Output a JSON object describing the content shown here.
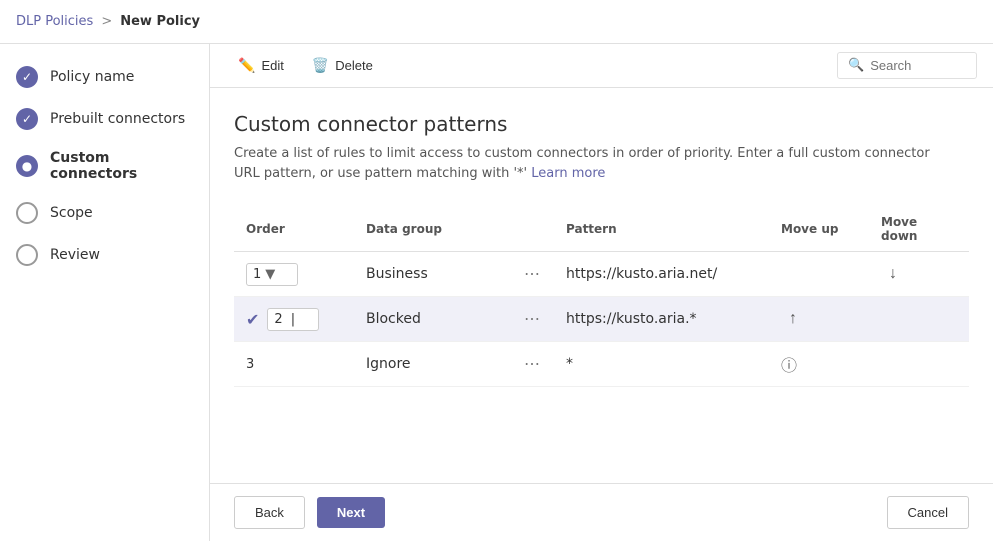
{
  "breadcrumb": {
    "parent": "DLP Policies",
    "separator": ">",
    "current": "New Policy"
  },
  "sidebar": {
    "items": [
      {
        "id": "policy-name",
        "label": "Policy name",
        "state": "completed",
        "stepNum": ""
      },
      {
        "id": "prebuilt-connectors",
        "label": "Prebuilt connectors",
        "state": "completed",
        "stepNum": ""
      },
      {
        "id": "custom-connectors",
        "label": "Custom connectors",
        "state": "active",
        "stepNum": ""
      },
      {
        "id": "scope",
        "label": "Scope",
        "state": "inactive",
        "stepNum": ""
      },
      {
        "id": "review",
        "label": "Review",
        "state": "inactive",
        "stepNum": ""
      }
    ]
  },
  "toolbar": {
    "edit_label": "Edit",
    "delete_label": "Delete",
    "search_placeholder": "Search"
  },
  "page": {
    "title": "Custom connector patterns",
    "description": "Create a list of rules to limit access to custom connectors in order of priority. Enter a full custom connector URL pattern, or use pattern matching with '*'",
    "learn_more": "Learn more"
  },
  "table": {
    "columns": {
      "order": "Order",
      "data_group": "Data group",
      "pattern": "Pattern",
      "move_up": "Move up",
      "move_down": "Move down"
    },
    "rows": [
      {
        "order": "1",
        "has_select": true,
        "data_group": "Business",
        "pattern": "https://kusto.aria.net/",
        "highlighted": false,
        "has_check": false,
        "move_up": false,
        "move_down": true
      },
      {
        "order": "2",
        "has_select": true,
        "data_group": "Blocked",
        "pattern": "https://kusto.aria.*",
        "highlighted": true,
        "has_check": true,
        "move_up": true,
        "move_down": false
      },
      {
        "order": "3",
        "has_select": false,
        "data_group": "Ignore",
        "pattern": "*",
        "highlighted": false,
        "has_check": false,
        "move_up": false,
        "move_down": false,
        "has_info": true
      }
    ]
  },
  "footer": {
    "back_label": "Back",
    "next_label": "Next",
    "cancel_label": "Cancel"
  }
}
